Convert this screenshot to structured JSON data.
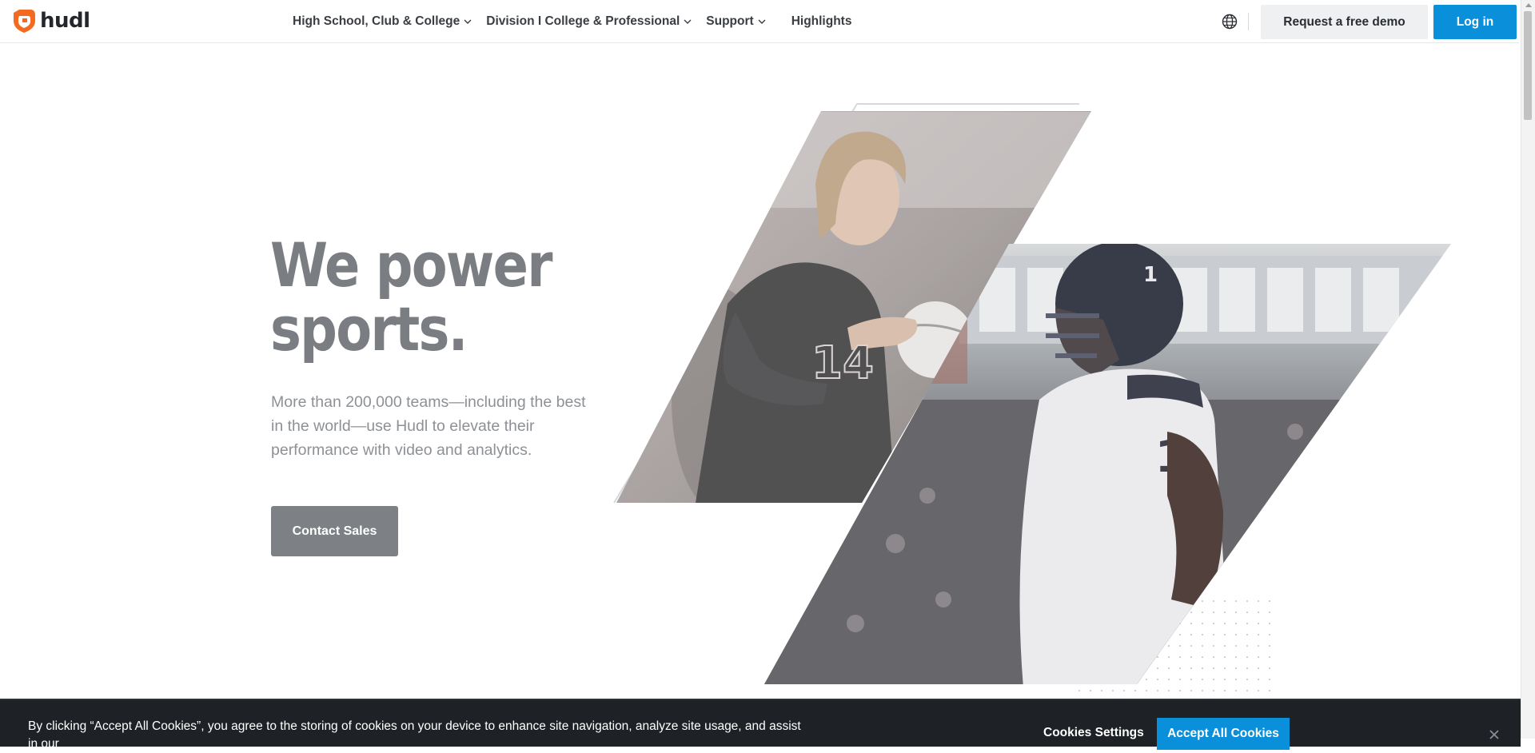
{
  "brand": {
    "name": "hudl",
    "accent": "#f36b21"
  },
  "nav": {
    "items": [
      {
        "label": "High School, Club & College",
        "has_dropdown": true
      },
      {
        "label": "Division I College & Professional",
        "has_dropdown": true
      },
      {
        "label": "Support",
        "has_dropdown": true
      }
    ],
    "highlights": "Highlights",
    "globe_icon": "globe-icon",
    "demo_label": "Request a free demo",
    "login_label": "Log in",
    "login_color": "#0a8fdb"
  },
  "hero": {
    "title_line1": "We power",
    "title_line2": "sports.",
    "description": "More than 200,000 teams—including the best in the world—use Hudl to elevate their performance with video and analytics.",
    "cta": "Contact Sales",
    "images": [
      {
        "alt": "Volleyball player in black jersey number 14 holding a ball"
      },
      {
        "alt": "Football player in white jersey number 1 wearing helmet"
      }
    ]
  },
  "cookie_banner": {
    "text": "By clicking “Accept All Cookies”, you agree to the storing of cookies on your device to enhance site navigation, analyze site usage, and assist in our",
    "settings_label": "Cookies Settings",
    "accept_label": "Accept All Cookies"
  }
}
